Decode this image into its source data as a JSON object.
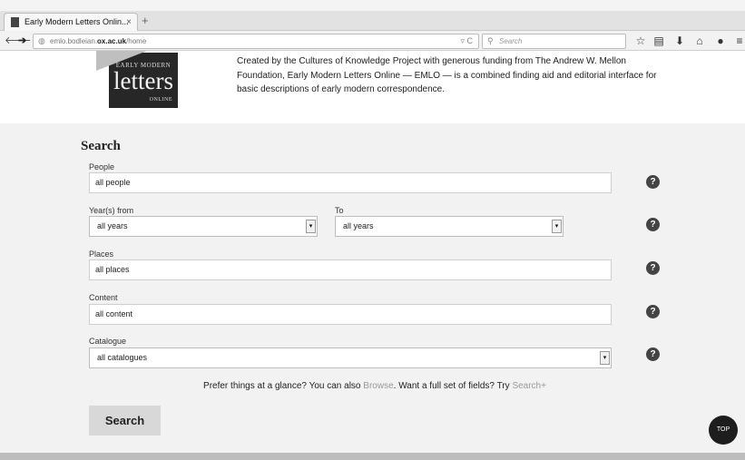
{
  "browser": {
    "tab_title": "Early Modern Letters Onlin...",
    "tab_close": "×",
    "new_tab": "+",
    "url_plain": "emlo.bodleian.",
    "url_bold": "ox.ac.uk",
    "url_path": "/home",
    "url_tools": "▿ C",
    "search_placeholder": "Search",
    "icons": [
      "back-icon",
      "forward-icon",
      "globe-icon",
      "reload-icon",
      "search-icon",
      "bookmark-star-icon",
      "clipboard-icon",
      "download-icon",
      "home-icon",
      "chat-icon",
      "menu-icon"
    ]
  },
  "header": {
    "logo_top": "EARLY MODERN",
    "logo_main": "letters",
    "logo_bottom": "ONLINE",
    "intro": "Created by the Cultures of Knowledge Project with generous funding from The Andrew W. Mellon Foundation, Early Modern Letters Online — EMLO — is a combined finding aid and editorial interface for basic descriptions of early modern correspondence."
  },
  "search": {
    "title": "Search",
    "people_label": "People",
    "people_value": "all people",
    "year_from_label": "Year(s) from",
    "year_from_value": "all years",
    "year_to_label": "To",
    "year_to_value": "all years",
    "places_label": "Places",
    "places_value": "all places",
    "content_label": "Content",
    "content_value": "all content",
    "catalogue_label": "Catalogue",
    "catalogue_value": "all catalogues",
    "help_glyph": "?",
    "select_arrow": "▾",
    "glance_pre": "Prefer things at a glance? You can also ",
    "browse_link": "Browse",
    "glance_mid": ". Want a full set of fields? Try ",
    "search_plus_link": "Search+",
    "button": "Search"
  },
  "top_button": "TOP",
  "colors": {
    "section_bg": "#f2f2f2",
    "button_bg": "#d8d8d8",
    "link": "#9a9a9a",
    "help_bg": "#444444"
  }
}
